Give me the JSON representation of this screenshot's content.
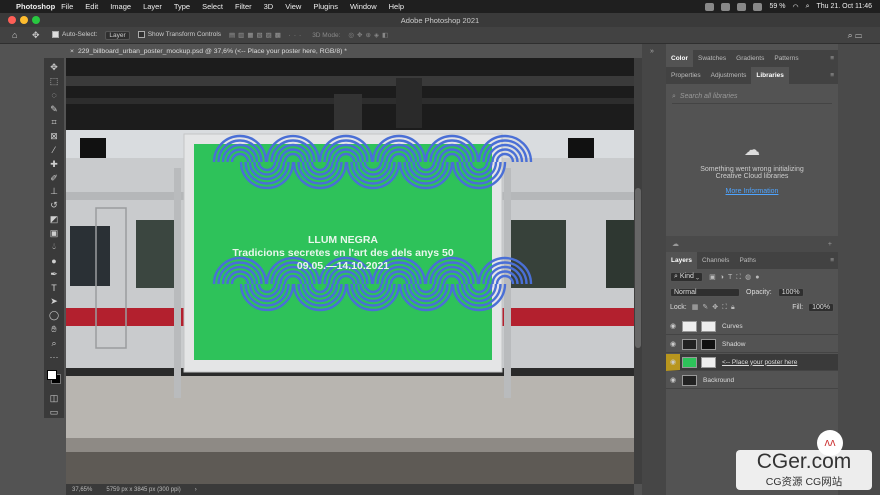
{
  "menubar": {
    "app": "Photoshop",
    "items": [
      "File",
      "Edit",
      "Image",
      "Layer",
      "Type",
      "Select",
      "Filter",
      "3D",
      "View",
      "Plugins",
      "Window",
      "Help"
    ],
    "battery": "59 %",
    "datetime": "Thu 21. Oct  11:46"
  },
  "window": {
    "title": "Adobe Photoshop 2021"
  },
  "options": {
    "auto_select": "Auto-Select:",
    "layer_dd": "Layer",
    "transform": "Show Transform Controls",
    "mode3d": "3D Mode:"
  },
  "doc": {
    "tab": "229_billboard_urban_poster_mockup.psd @ 37,6% (<-- Place your poster here, RGB/8) *",
    "zoom": "37,65%",
    "size": "5759 px x 3845 px (300 ppi)"
  },
  "poster": {
    "title": "LLUM NEGRA",
    "subtitle": "Tradicions secretes en l'art des dels anys 50",
    "dates": "09.05.—14.10.2021",
    "color": "#2ec25a",
    "wave_color": "#4a6fd6"
  },
  "panels": {
    "top_tabs": [
      "Color",
      "Swatches",
      "Gradients",
      "Patterns"
    ],
    "mid_tabs": [
      "Properties",
      "Adjustments",
      "Libraries"
    ],
    "search_placeholder": "Search all libraries",
    "lib_msg1": "Something went wrong initializing",
    "lib_msg2": "Creative Cloud libraries",
    "lib_link": "More Information",
    "layer_tabs": [
      "Layers",
      "Channels",
      "Paths"
    ],
    "kind": "Kind",
    "blend": "Normal",
    "opacity_label": "Opacity:",
    "opacity": "100%",
    "lock_label": "Lock:",
    "fill_label": "Fill:",
    "fill": "100%"
  },
  "layers": [
    {
      "name": "Curves"
    },
    {
      "name": "Shadow"
    },
    {
      "name": "<-- Place your poster here"
    },
    {
      "name": "Backround"
    }
  ],
  "watermark": {
    "brand": "CGer.com",
    "sub": "CG资源  CG网站"
  }
}
